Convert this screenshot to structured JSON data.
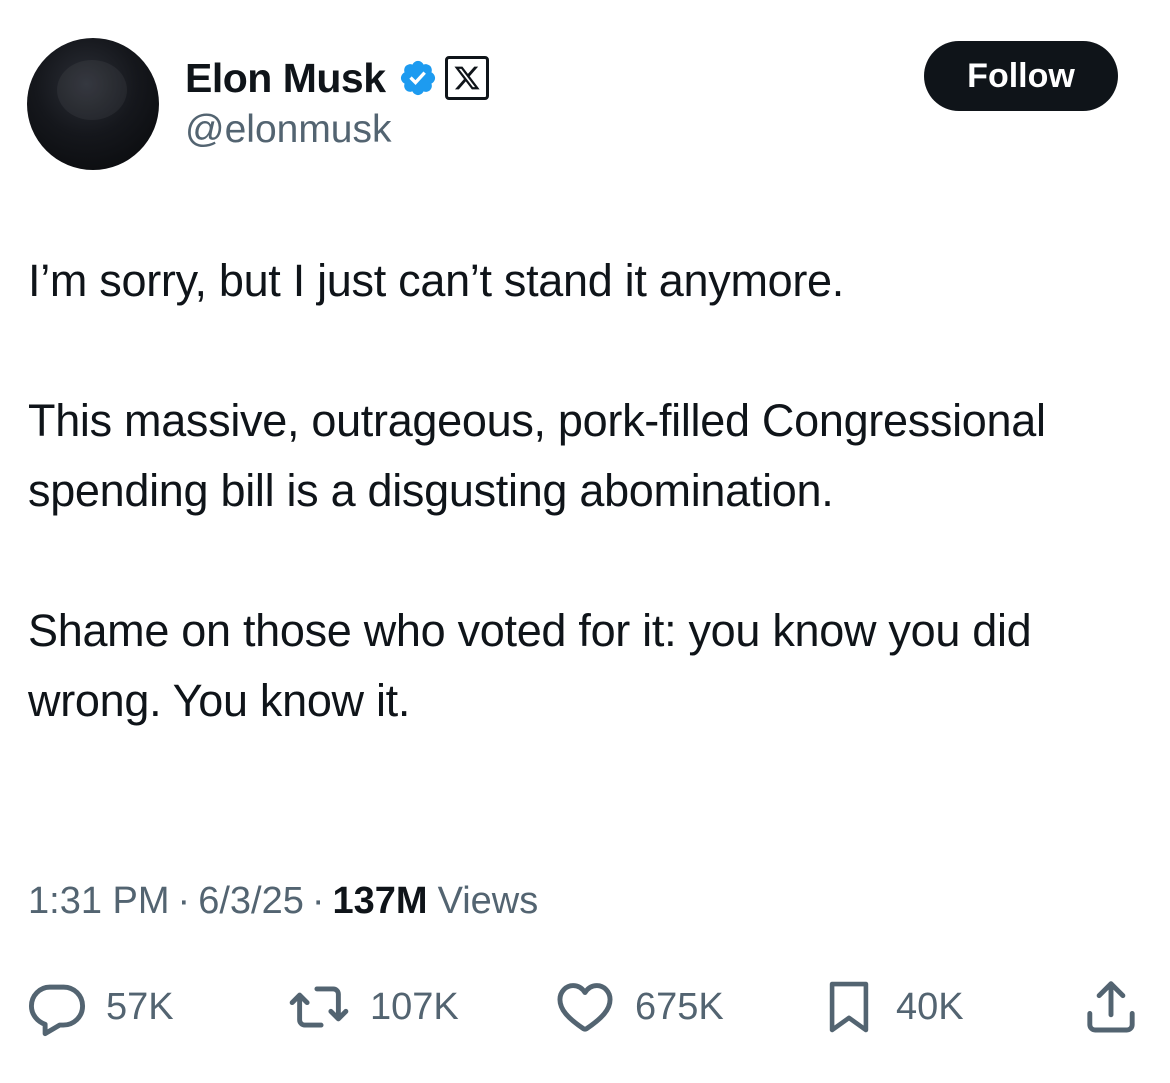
{
  "author": {
    "display_name": "Elon Musk",
    "handle": "@elonmusk",
    "verified": true,
    "affiliate_badge": "x-logo"
  },
  "follow_button": {
    "label": "Follow"
  },
  "tweet": {
    "paragraphs": [
      "I’m sorry, but I just can’t stand it anymore.",
      "This massive, outrageous, pork-filled Congressional spending bill is a disgusting abomination.",
      "Shame on those who voted for it: you know you did wrong. You know it."
    ]
  },
  "meta": {
    "time": "1:31 PM",
    "separator": "·",
    "date": "6/3/25",
    "views_count": "137M",
    "views_label": "Views"
  },
  "actions": {
    "replies": "57K",
    "reposts": "107K",
    "likes": "675K",
    "bookmarks": "40K"
  },
  "colors": {
    "text_primary": "#0f1419",
    "text_secondary": "#536471",
    "verified_blue": "#1d9bf0",
    "follow_bg": "#0f1419"
  }
}
